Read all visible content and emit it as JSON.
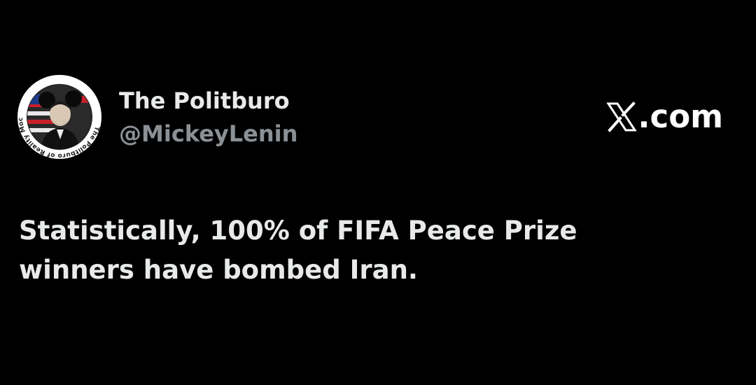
{
  "author": {
    "display_name": "The Politburo",
    "handle": "@MickeyLenin",
    "avatar_text": "The Politburo of Reality Mockery"
  },
  "branding": {
    "site": ".com",
    "logo_icon": "x-logo-icon"
  },
  "tweet": {
    "lines": [
      "Statistically, 100% of FIFA Peace Prize",
      "winners have bombed Iran."
    ]
  },
  "colors": {
    "background": "#000000",
    "primary_text": "#e7e9ea",
    "secondary_text": "#8b9095",
    "accent_red": "#c8202a",
    "accent_blue": "#1d3a8a"
  }
}
